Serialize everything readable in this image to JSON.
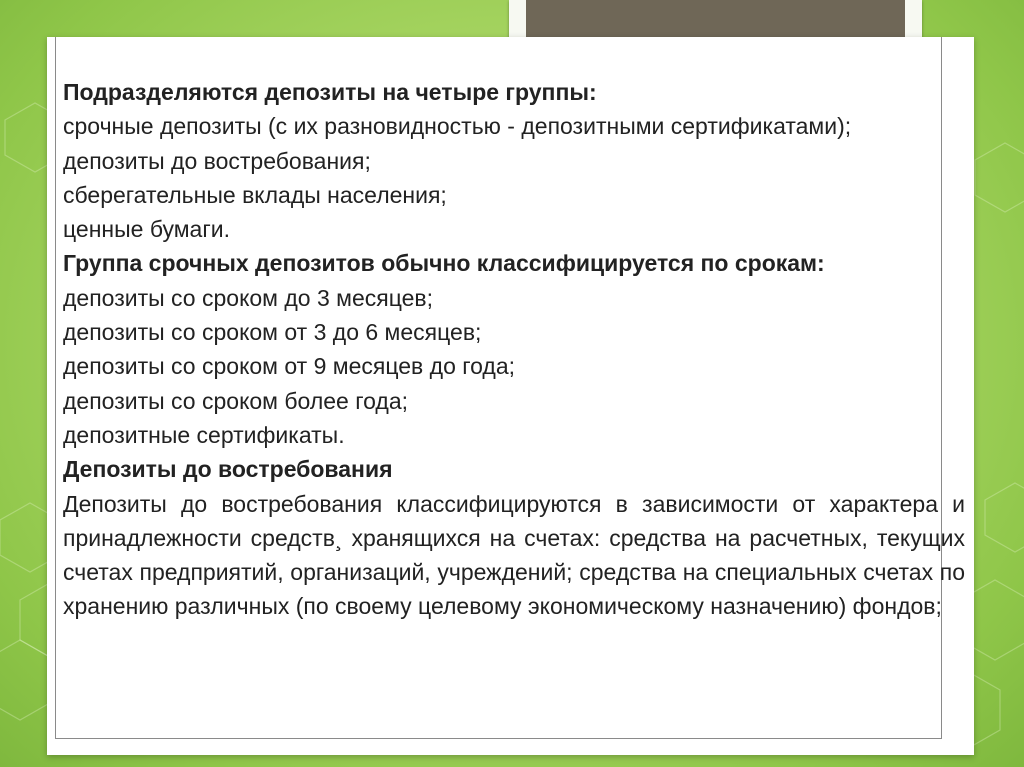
{
  "slide": {
    "lines": [
      {
        "text": "Подразделяются депозиты на четыре группы:",
        "bold": true
      },
      {
        "text": "срочные депозиты (с их разновидностью - депозитными сертификатами);",
        "bold": false
      },
      {
        "text": "депозиты до востребования;",
        "bold": false
      },
      {
        "text": "сберегательные вклады населения;",
        "bold": false
      },
      {
        "text": "ценные бумаги.",
        "bold": false
      },
      {
        "text": "Группа срочных депозитов обычно классифицируется по срокам:",
        "bold": true
      },
      {
        "text": "депозиты со сроком до 3 месяцев;",
        "bold": false
      },
      {
        "text": "депозиты со сроком от 3 до 6 месяцев;",
        "bold": false
      },
      {
        "text": "депозиты со сроком от 9 месяцев до года;",
        "bold": false
      },
      {
        "text": "депозиты со сроком более года;",
        "bold": false
      },
      {
        "text": "депозитные сертификаты.",
        "bold": false
      },
      {
        "text": "Депозиты до востребования",
        "bold": true
      },
      {
        "text": "Депозиты до востребования классифицируются в зависимости от характера и принадлежности средств¸ хранящихся на счетах: средства на расчетных, текущих счетах предприятий, организаций, учреждений; средства на специальных счетах по хранению различных (по своему целевому экономическому назначению) фондов;",
        "bold": false
      }
    ]
  },
  "colors": {
    "background": "#a9d664",
    "title_block": "#6f6757",
    "panel": "#ffffff",
    "text": "#222222"
  }
}
